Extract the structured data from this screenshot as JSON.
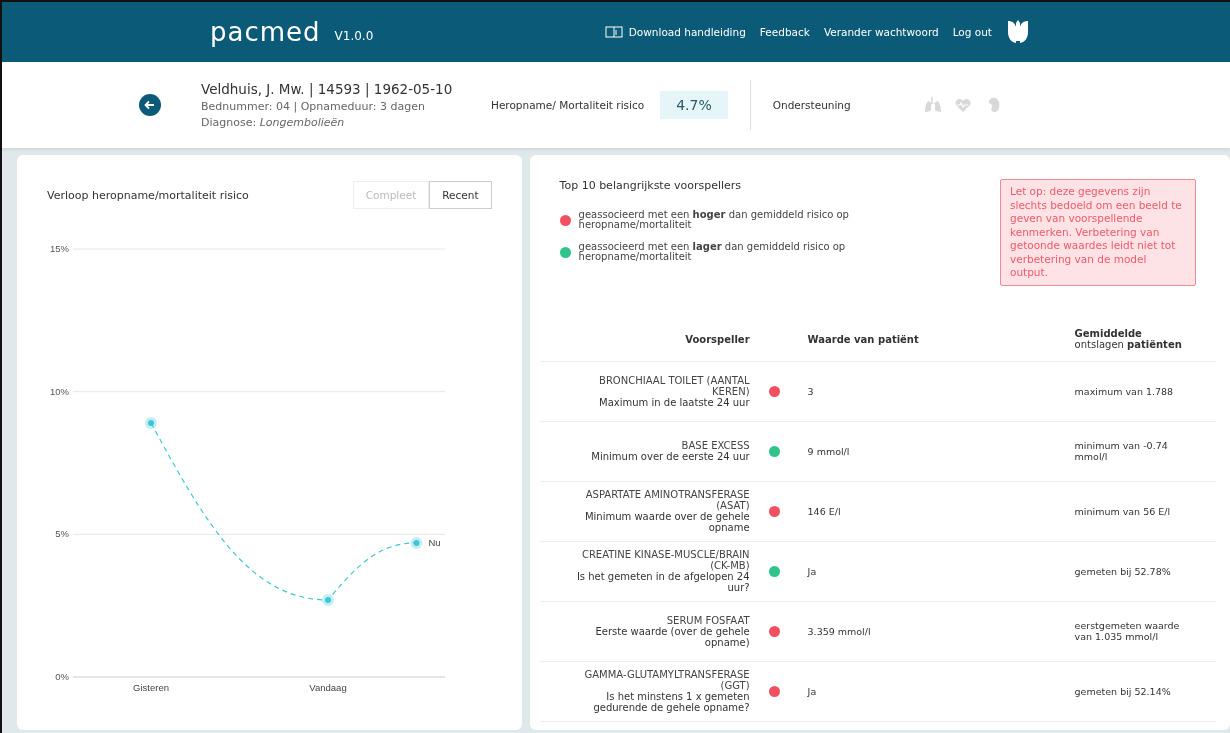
{
  "header": {
    "logo": "pacmed",
    "version": "V1.0.0",
    "nav": [
      {
        "kind": "download",
        "label": "Download handleiding"
      },
      {
        "kind": "link",
        "label": "Feedback"
      },
      {
        "kind": "link",
        "label": "Verander wachtwoord"
      },
      {
        "kind": "link",
        "label": "Log out"
      }
    ]
  },
  "patient": {
    "name": "Veldhuis, J. Mw. | 14593 | 1962-05-10",
    "details": "Bednummer: 04 | Opnameduur: 3 dagen",
    "diagnosis": "Diagnose: *Longembolieën*",
    "risk_label": "Heropname/ Mortaliteit risico",
    "risk_value": "4.7%",
    "support_label": "Ondersteuning",
    "support": [
      {
        "kind": "lungs",
        "active": false
      },
      {
        "kind": "heart",
        "active": false
      },
      {
        "kind": "kidney",
        "active": false
      }
    ]
  },
  "trend": {
    "title": "Verloop heropname/mortaliteit risico",
    "toggle": [
      {
        "label": "Compleet",
        "selected": false
      },
      {
        "label": "Recent",
        "selected": true
      }
    ],
    "chart_data": {
      "type": "line",
      "categories": [
        "Gisteren",
        null,
        "Vandaag",
        null
      ],
      "series": [
        {
          "color": "#3ec6d8",
          "line_style": "dashed",
          "marker": "circle",
          "values": [
            8.9,
            null,
            2.7,
            4.7
          ]
        }
      ],
      "annotations": [
        "Nu"
      ],
      "ylim": [
        0,
        15
      ],
      "yticks": [
        {
          "value": 0,
          "label": "0%"
        },
        {
          "value": 5,
          "label": "5%"
        },
        {
          "value": 10,
          "label": "10%"
        },
        {
          "value": 15,
          "label": "15%"
        }
      ]
    }
  },
  "predictors": {
    "title": "Top 10 belangrijkste voorspellers",
    "legend": [
      {
        "color": "#f25060",
        "text": "geassocieerd met een **hoger** dan gemiddeld risico op heropname/mortaliteit"
      },
      {
        "color": "#2ec48a",
        "text": "geassocieerd met een **lager** dan gemiddeld risico op heropname/mortaliteit"
      }
    ],
    "warning": "Let op: deze gegevens zijn slechts bedoeld om een beeld te geven van voorspellende kenmerken. Verbetering van getoonde waardes leidt niet tot verbetering van de model output.",
    "columns": [
      "Voorspeller",
      "Waarde van patiënt",
      "Gemiddelde\nontslagen **patiënten**"
    ],
    "rows": [
      {
        "name": "BRONCHIAAL TOILET (AANTAL KEREN)",
        "detail": "Maximum in de laatste 24 uur",
        "color": "#f25060",
        "value": "3",
        "average": "maximum van 1.788"
      },
      {
        "name": "BASE EXCESS",
        "detail": "Minimum over de eerste 24 uur",
        "color": "#2ec48a",
        "value": "9 mmol/l",
        "average": "minimum van -0.74 mmol/l"
      },
      {
        "name": "ASPARTATE AMINOTRANSFERASE (ASAT)",
        "detail": "Minimum waarde over de gehele opname",
        "color": "#f25060",
        "value": "146 E/l",
        "average": "minimum van 56 E/l"
      },
      {
        "name": "CREATINE KINASE-MUSCLE/BRAIN (CK-MB)",
        "detail": "Is het gemeten in de afgelopen 24 uur?",
        "color": "#2ec48a",
        "value": "Ja",
        "average": "gemeten bij 52.78%"
      },
      {
        "name": "SERUM FOSFAAT",
        "detail": "Eerste waarde (over de gehele opname)",
        "color": "#f25060",
        "value": "3.359 mmol/l",
        "average": "eerstgemeten waarde van 1.035 mmol/l"
      },
      {
        "name": "GAMMA-GLUTAMYLTRANSFERASE (GGT)",
        "detail": "Is het minstens 1 x gemeten gedurende de gehele opname?",
        "color": "#f25060",
        "value": "Ja",
        "average": "gemeten bij 52.14%"
      }
    ]
  }
}
